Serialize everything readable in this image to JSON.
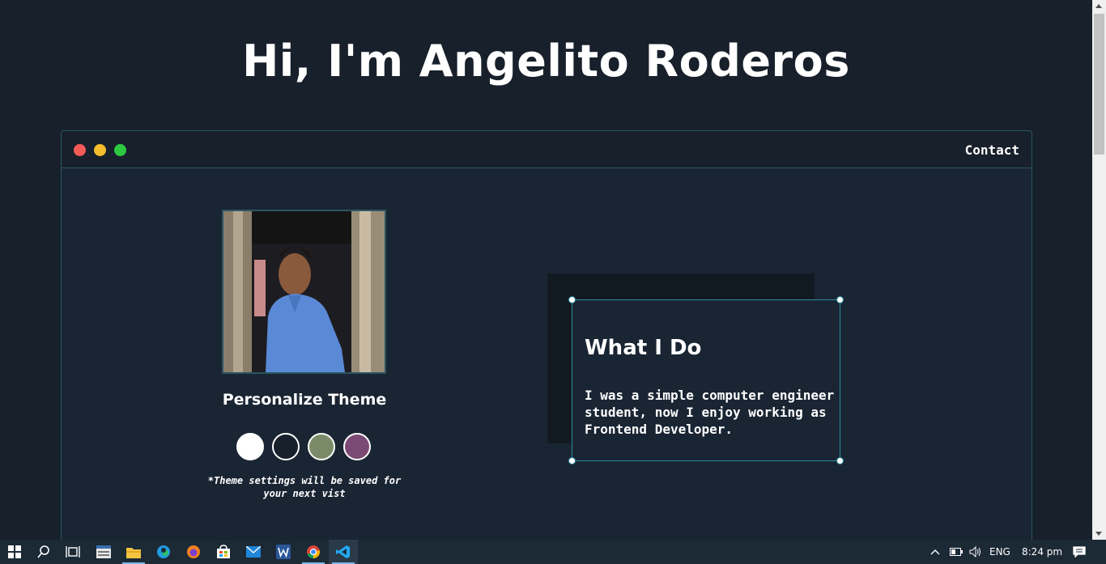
{
  "page": {
    "title": "Hi, I'm Angelito Roderos"
  },
  "window": {
    "nav": {
      "contact_label": "Contact"
    }
  },
  "profile": {
    "theme_title": "Personalize Theme",
    "theme_swatches": [
      {
        "name": "light",
        "color": "#ffffff"
      },
      {
        "name": "dark",
        "color": "#17202b"
      },
      {
        "name": "green",
        "color": "#7b8a68"
      },
      {
        "name": "purple",
        "color": "#7b4a74"
      }
    ],
    "theme_note": "*Theme settings will be saved for your next vist"
  },
  "about": {
    "heading": "What I Do",
    "text": "I was a simple computer engineer student, now I enjoy working as Frontend Developer."
  },
  "taskbar": {
    "language": "ENG",
    "time": "8:24 pm",
    "apps": [
      "start-icon",
      "search-icon",
      "task-view-icon",
      "calculator-icon",
      "file-explorer-icon",
      "edge-icon",
      "firefox-icon",
      "store-icon",
      "mail-icon",
      "word-icon",
      "chrome-icon",
      "vscode-icon"
    ]
  }
}
